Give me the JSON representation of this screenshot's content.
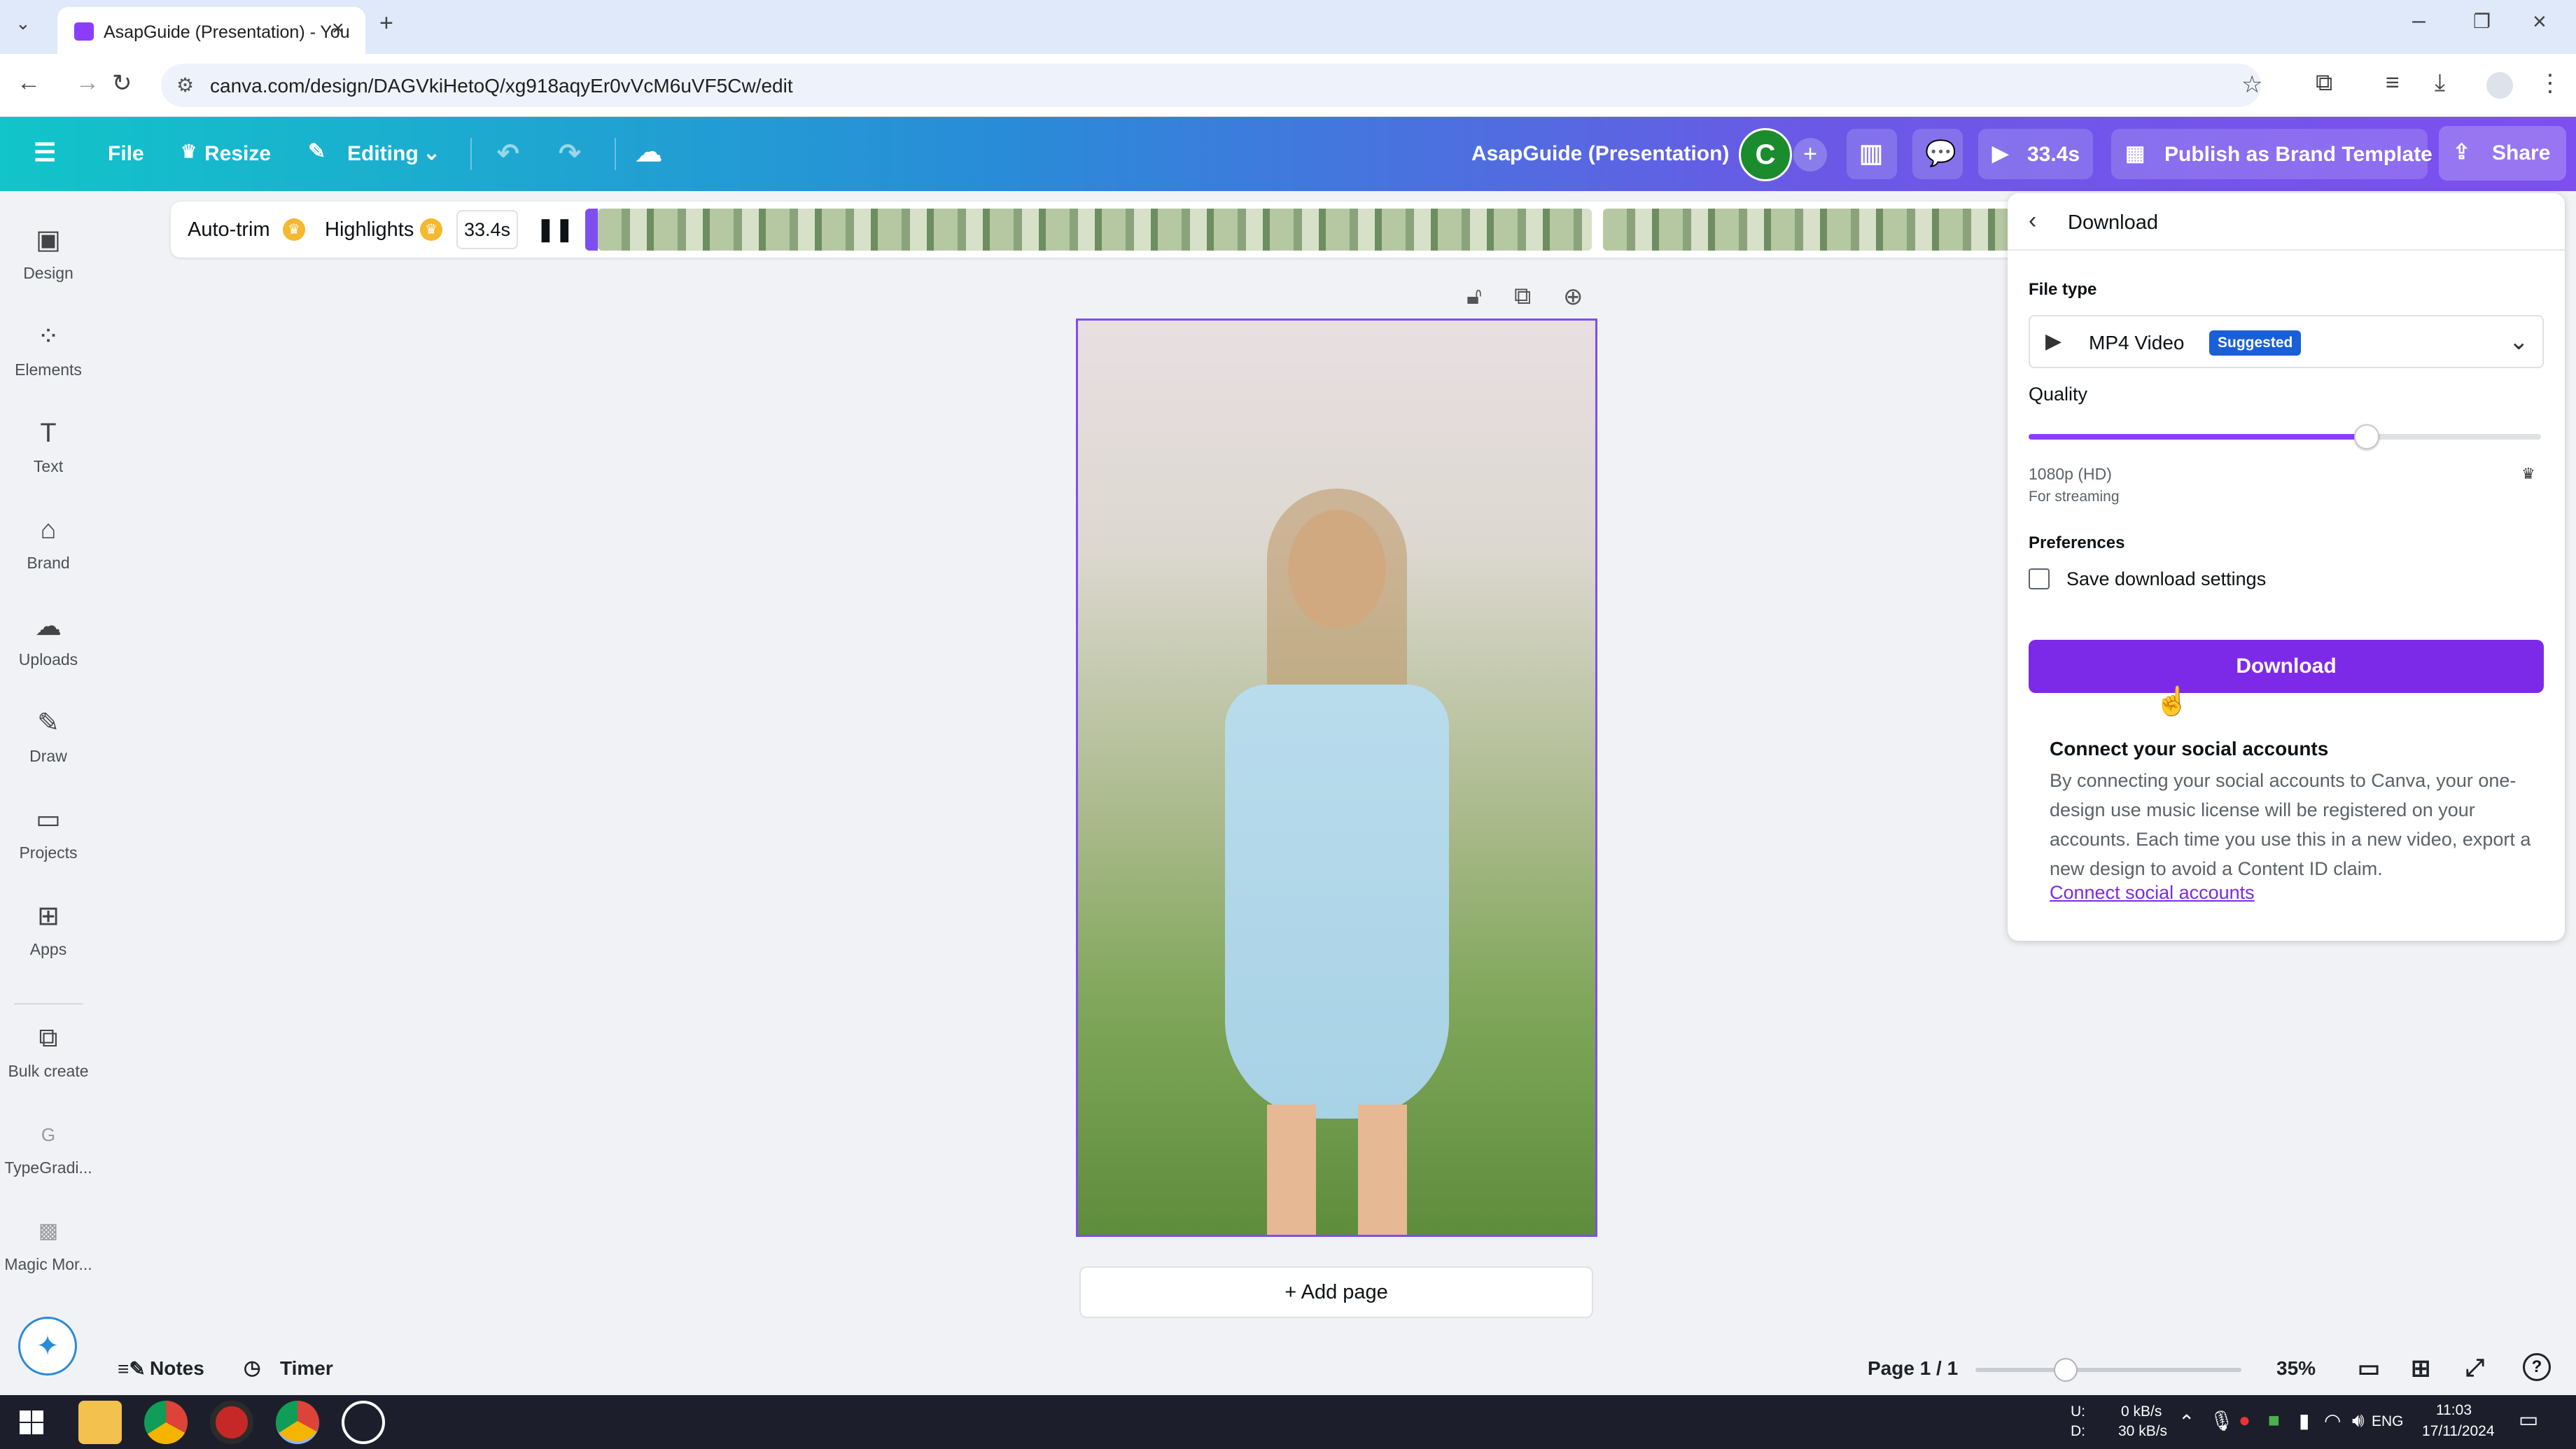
{
  "browser": {
    "tab_title": "AsapGuide (Presentation) - You",
    "url": "canva.com/design/DAGVkiHetoQ/xg918aqyEr0vVcM6uVF5Cw/edit"
  },
  "toolbar": {
    "file_label": "File",
    "resize_label": "Resize",
    "editing_label": "Editing",
    "doc_title": "AsapGuide (Presentation)",
    "avatar_letter": "C",
    "play_label": "33.4s",
    "publish_label": "Publish as Brand Template",
    "share_label": "Share"
  },
  "sidebar": {
    "items": [
      {
        "label": "Design",
        "icon": "design-icon"
      },
      {
        "label": "Elements",
        "icon": "elements-icon"
      },
      {
        "label": "Text",
        "icon": "text-icon"
      },
      {
        "label": "Brand",
        "icon": "brand-icon"
      },
      {
        "label": "Uploads",
        "icon": "uploads-icon"
      },
      {
        "label": "Draw",
        "icon": "draw-icon"
      },
      {
        "label": "Projects",
        "icon": "projects-icon"
      },
      {
        "label": "Apps",
        "icon": "apps-icon"
      },
      {
        "label": "Bulk create",
        "icon": "bulk-create-icon"
      },
      {
        "label": "TypeGradi...",
        "icon": "typegradient-icon"
      },
      {
        "label": "Magic Mor...",
        "icon": "magic-morph-icon"
      }
    ]
  },
  "timeline": {
    "autotrim_label": "Auto-trim",
    "highlights_label": "Highlights",
    "duration": "33.4s"
  },
  "canvas": {
    "add_page_label": "+ Add page"
  },
  "download_panel": {
    "title": "Download",
    "file_type_label": "File type",
    "file_type_value": "MP4 Video",
    "suggested_badge": "Suggested",
    "quality_label": "Quality",
    "quality_fraction": 0.66,
    "quality_value": "1080p (HD)",
    "quality_sub": "For streaming",
    "preferences_label": "Preferences",
    "save_settings_label": "Save download settings",
    "download_button": "Download",
    "connect_title": "Connect your social accounts",
    "connect_body": "By connecting your social accounts to Canva, your one-design use music license will be registered on your accounts. Each time you use this in a new video, export a new design to avoid a Content ID claim.",
    "connect_link": "Connect social accounts"
  },
  "bottom": {
    "notes_label": "Notes",
    "timer_label": "Timer",
    "page_indicator": "Page 1 / 1",
    "zoom_fraction": 0.34,
    "zoom_label": "35%"
  },
  "taskbar": {
    "net_up_label": "U:",
    "net_down_label": "D:",
    "net_up": "0 kB/s",
    "net_down": "30 kB/s",
    "lang": "ENG",
    "time": "11:03",
    "date": "17/11/2024"
  },
  "colors": {
    "accent": "#7d2ae8",
    "selection": "#7d4ff0",
    "suggested_badge": "#1a5ed8"
  }
}
